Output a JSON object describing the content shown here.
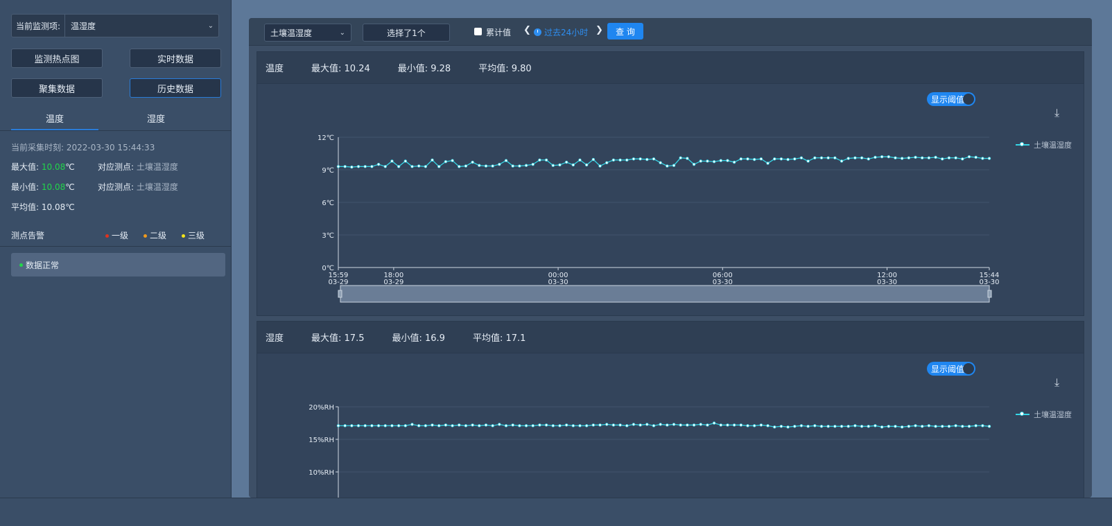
{
  "left": {
    "monitor_label": "当前监测项:",
    "monitor_value": "温湿度",
    "buttons": [
      "监测热点图",
      "实时数据",
      "聚集数据",
      "历史数据"
    ],
    "tabs": [
      "温度",
      "湿度"
    ],
    "collect_label": "当前采集时刻:",
    "collect_time": "2022-03-30 15:44:33",
    "max_label": "最大值:",
    "max_value": "10.08",
    "min_label": "最小值:",
    "min_value": "10.08",
    "unit": "℃",
    "point_label": "对应测点:",
    "point_value": "土壤温湿度",
    "avg_label": "平均值:",
    "avg_value": "10.08℃",
    "alarm_title": "测点告警",
    "levels": [
      {
        "label": "一级",
        "color": "#e0321e"
      },
      {
        "label": "二级",
        "color": "#f09a1c"
      },
      {
        "label": "三级",
        "color": "#f5e51a"
      }
    ],
    "alarm_status": "数据正常",
    "alarm_status_color": "#22d64a"
  },
  "toolbar": {
    "device": "土壤温湿度",
    "selected": "选择了1个",
    "cumulative": "累计值",
    "range": "过去24小时",
    "query": "查 询"
  },
  "panels": [
    {
      "title": "温度",
      "max": "最大值: 10.24",
      "min": "最小值: 9.28",
      "avg": "平均值: 9.80",
      "toggle": "显示阈值",
      "legend": "土壤温湿度"
    },
    {
      "title": "湿度",
      "max": "最大值: 17.5",
      "min": "最小值: 16.9",
      "avg": "平均值: 17.1",
      "toggle": "显示阈值",
      "legend": "土壤温湿度"
    }
  ],
  "chart_data": [
    {
      "type": "line",
      "series_name": "土壤温湿度",
      "y_ticks": [
        "0℃",
        "3℃",
        "6℃",
        "9℃",
        "12℃"
      ],
      "ylim": [
        0,
        12
      ],
      "x_ticks": [
        {
          "time": "15:59",
          "date": "03-29"
        },
        {
          "time": "18:00",
          "date": "03-29"
        },
        {
          "time": "00:00",
          "date": "03-30"
        },
        {
          "time": "06:00",
          "date": "03-30"
        },
        {
          "time": "12:00",
          "date": "03-30"
        },
        {
          "time": "15:44",
          "date": "03-30"
        }
      ],
      "x_tick_hours": [
        0,
        2.02,
        8.02,
        14.02,
        20.02,
        23.75
      ],
      "x_span_hours": 23.75,
      "values": [
        9.3,
        9.3,
        9.25,
        9.3,
        9.3,
        9.3,
        9.5,
        9.3,
        9.8,
        9.3,
        9.8,
        9.3,
        9.35,
        9.3,
        9.9,
        9.3,
        9.75,
        9.85,
        9.3,
        9.35,
        9.7,
        9.4,
        9.35,
        9.35,
        9.5,
        9.85,
        9.35,
        9.35,
        9.4,
        9.5,
        9.9,
        9.9,
        9.4,
        9.45,
        9.7,
        9.45,
        9.9,
        9.45,
        9.95,
        9.35,
        9.65,
        9.9,
        9.9,
        9.9,
        10.0,
        10.0,
        9.95,
        10.0,
        9.65,
        9.35,
        9.4,
        10.1,
        10.05,
        9.5,
        9.8,
        9.8,
        9.75,
        9.85,
        9.85,
        9.7,
        10.0,
        10.0,
        9.95,
        10.0,
        9.6,
        10.0,
        10.0,
        9.95,
        10.0,
        10.1,
        9.8,
        10.1,
        10.1,
        10.1,
        10.1,
        9.8,
        10.05,
        10.1,
        10.1,
        10.0,
        10.15,
        10.2,
        10.2,
        10.1,
        10.05,
        10.1,
        10.15,
        10.1,
        10.1,
        10.15,
        10.0,
        10.1,
        10.1,
        10.0,
        10.2,
        10.15,
        10.05,
        10.05
      ]
    },
    {
      "type": "line",
      "series_name": "土壤温湿度",
      "y_ticks": [
        "10%RH",
        "15%RH",
        "20%RH"
      ],
      "y_tick_values": [
        10,
        15,
        20
      ],
      "values": [
        17.1,
        17.1,
        17.1,
        17.1,
        17.1,
        17.1,
        17.1,
        17.1,
        17.1,
        17.1,
        17.1,
        17.3,
        17.1,
        17.1,
        17.2,
        17.1,
        17.2,
        17.1,
        17.2,
        17.1,
        17.2,
        17.1,
        17.2,
        17.1,
        17.3,
        17.1,
        17.2,
        17.1,
        17.1,
        17.1,
        17.2,
        17.2,
        17.1,
        17.1,
        17.2,
        17.1,
        17.1,
        17.1,
        17.2,
        17.2,
        17.3,
        17.2,
        17.2,
        17.1,
        17.3,
        17.2,
        17.3,
        17.1,
        17.3,
        17.2,
        17.3,
        17.2,
        17.2,
        17.2,
        17.3,
        17.2,
        17.5,
        17.2,
        17.2,
        17.2,
        17.2,
        17.1,
        17.1,
        17.2,
        17.1,
        16.9,
        17.0,
        16.9,
        17.0,
        17.1,
        17.0,
        17.1,
        17.0,
        17.0,
        17.0,
        17.0,
        17.0,
        17.1,
        17.0,
        17.0,
        17.1,
        16.9,
        17.0,
        17.0,
        16.9,
        17.0,
        17.1,
        17.0,
        17.1,
        17.0,
        17.0,
        17.0,
        17.1,
        17.0,
        17.0,
        17.1,
        17.1,
        17.0
      ]
    }
  ]
}
